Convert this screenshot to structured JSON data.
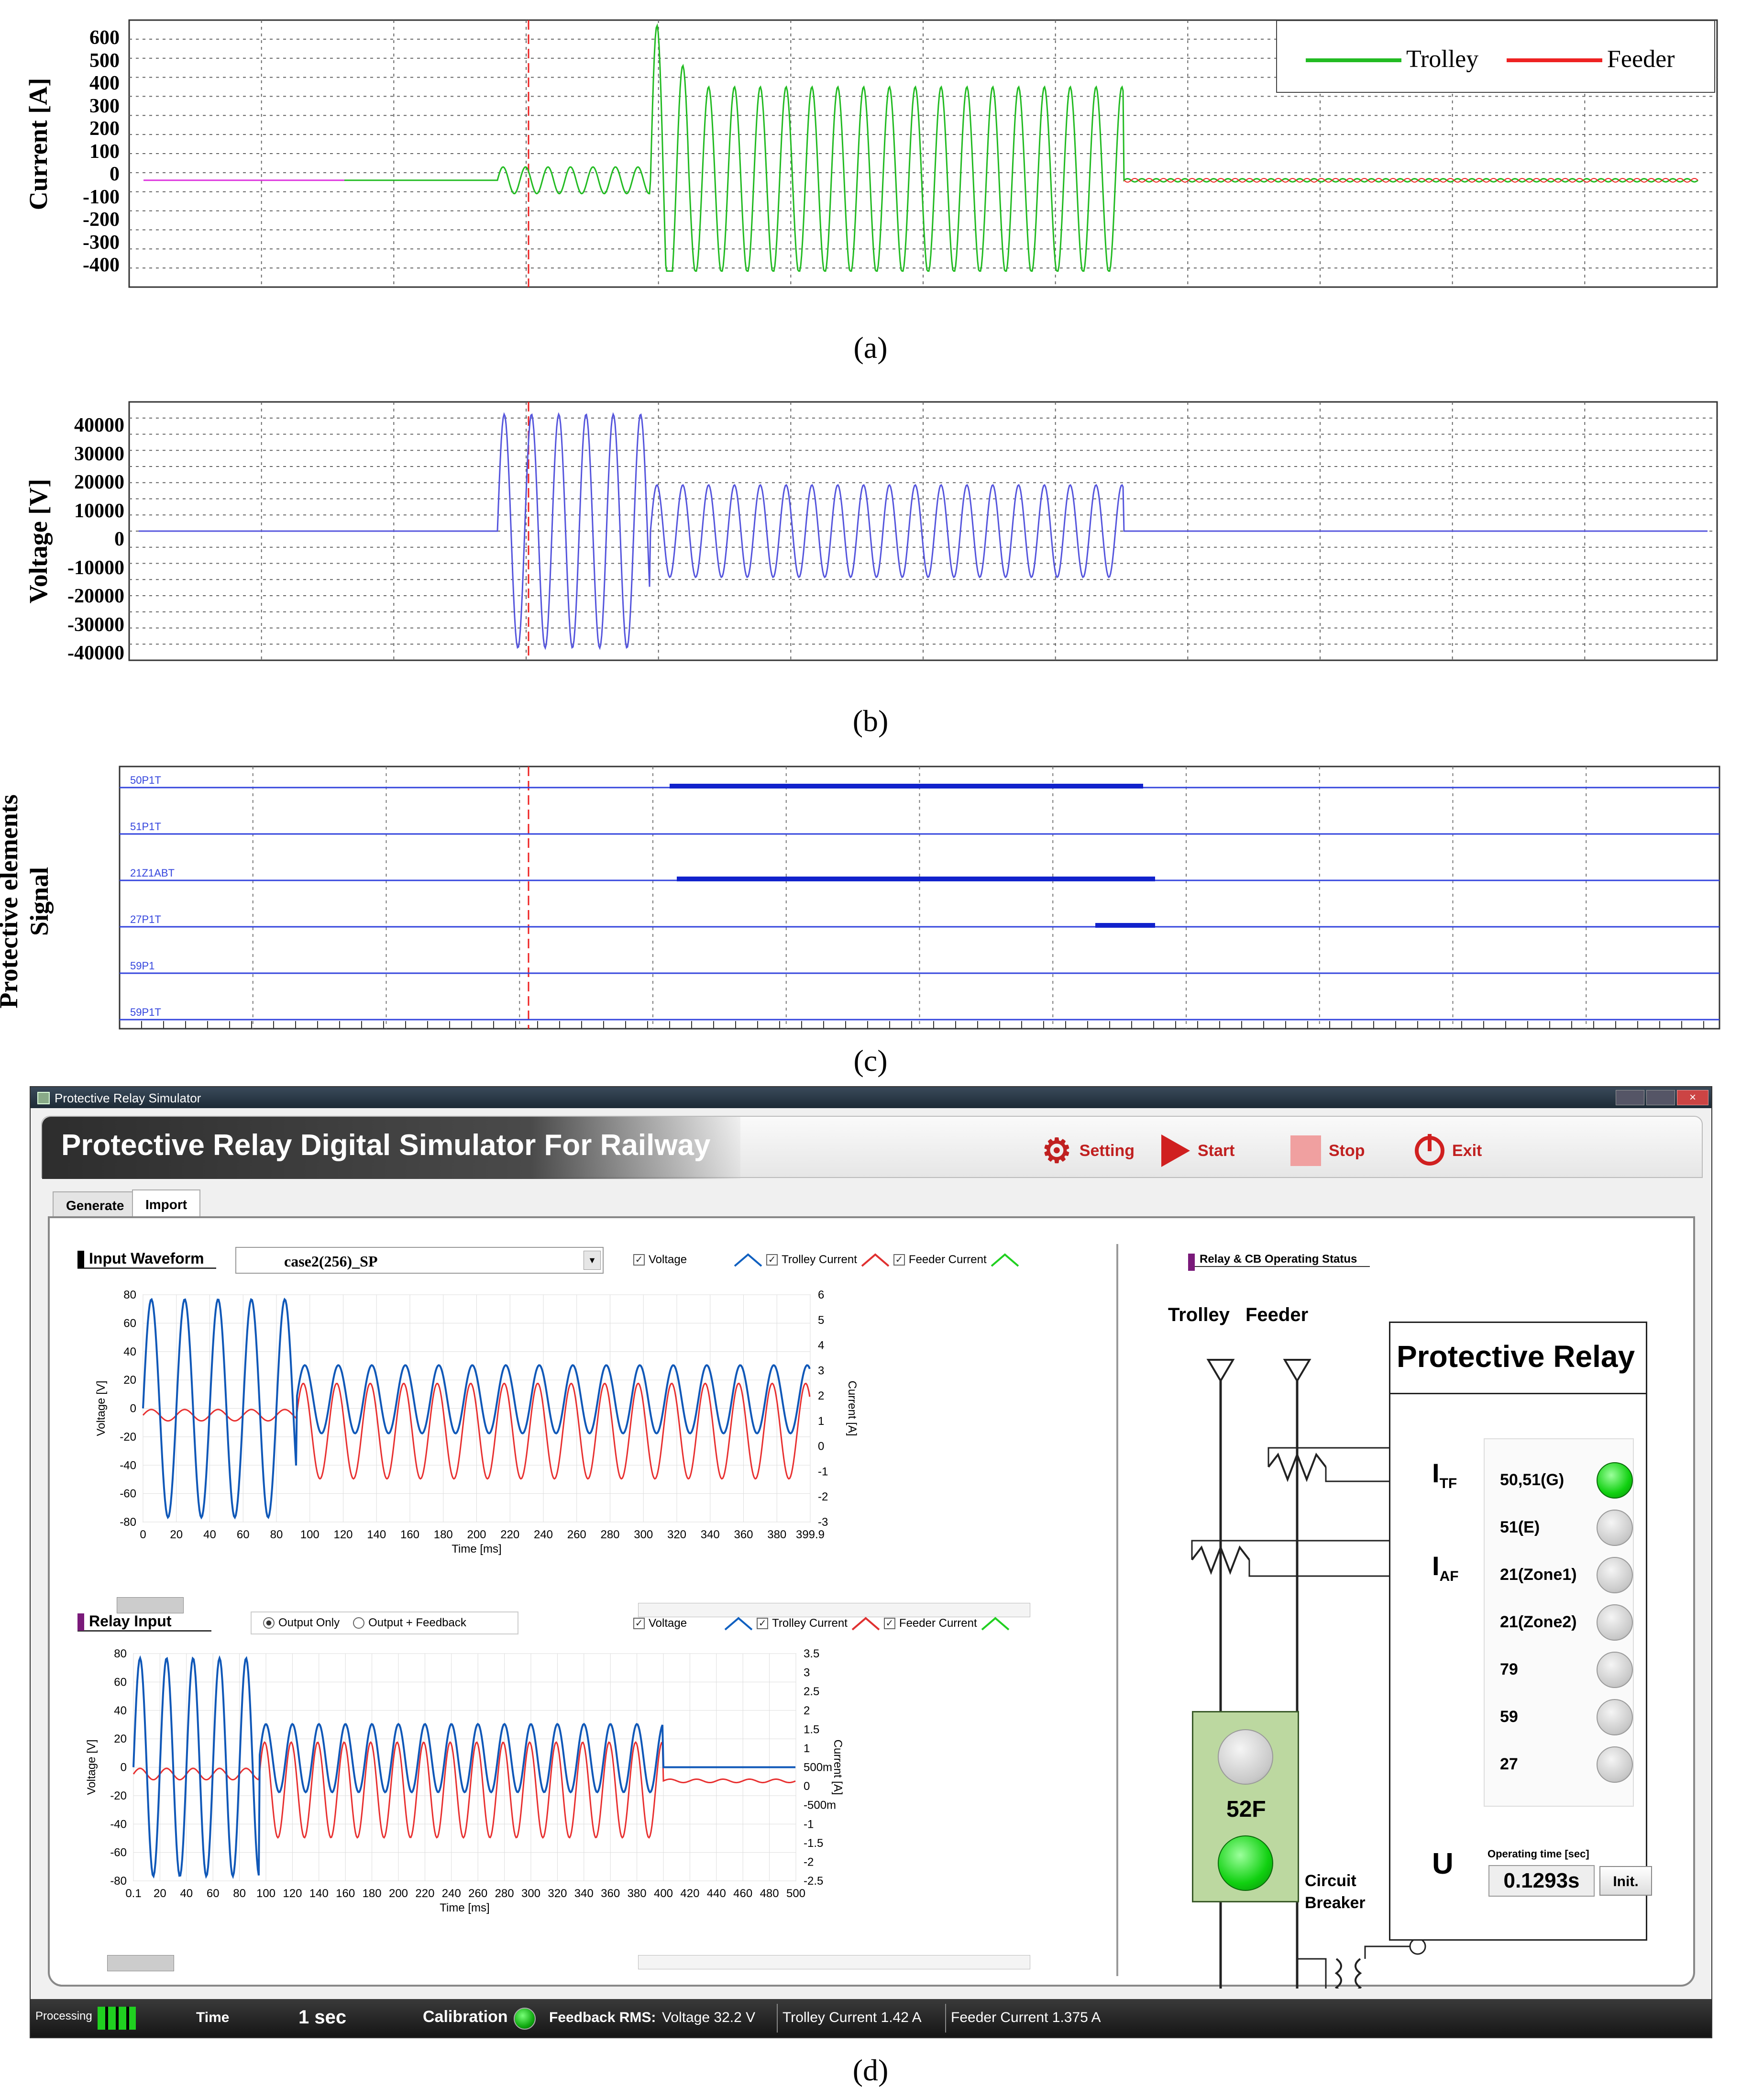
{
  "captions": {
    "a": "(a)",
    "b": "(b)",
    "c": "(c)",
    "d": "(d)"
  },
  "chart_a": {
    "ylabel": "Current [A]",
    "yticks": [
      "600",
      "500",
      "400",
      "300",
      "200",
      "100",
      "0",
      "-100",
      "-200",
      "-300",
      "-400"
    ],
    "legend": [
      {
        "name": "Trolley",
        "color": "#22bb22"
      },
      {
        "name": "Feeder",
        "color": "#ee2222"
      }
    ]
  },
  "chart_b": {
    "ylabel": "Voltage [V]",
    "yticks": [
      "40000",
      "30000",
      "20000",
      "10000",
      "0",
      "-10000",
      "-20000",
      "-30000",
      "-40000"
    ],
    "color": "#5555dd"
  },
  "chart_c": {
    "ylabel_line1": "Protective elements",
    "ylabel_line2": "Signal",
    "signals": [
      "50P1T",
      "51P1T",
      "21Z1ABT",
      "27P1T",
      "59P1",
      "59P1T"
    ]
  },
  "chart_data": [
    {
      "type": "line",
      "ylabel": "Current [A]",
      "ylim": [
        -400,
        600
      ],
      "series": [
        {
          "name": "Trolley",
          "peak_fault": 350,
          "peak_first": 580
        },
        {
          "name": "Feeder"
        }
      ],
      "grid": true,
      "legend": "top-right"
    },
    {
      "type": "line",
      "ylabel": "Voltage [V]",
      "ylim": [
        -40000,
        40000
      ],
      "series": [
        {
          "amplitude_pre": 38000,
          "amplitude_fault": 15000
        }
      ],
      "grid": true
    },
    {
      "type": "line",
      "ylabel": "Protective elements Signal",
      "categories": [
        "50P1T",
        "51P1T",
        "21Z1ABT",
        "27P1T",
        "59P1",
        "59P1T"
      ]
    }
  ],
  "app": {
    "window_title": "Protective Relay Simulator",
    "title": "Protective Relay Digital Simulator For Railway",
    "toolbar": {
      "setting": "Setting",
      "start": "Start",
      "stop": "Stop",
      "exit": "Exit"
    },
    "tabs": [
      "Generate",
      "Import"
    ],
    "input_waveform": {
      "title": "Input Waveform",
      "file": "case2(256)_SP",
      "checks": [
        "Voltage",
        "Trolley Current",
        "Feeder Current"
      ],
      "yleft": [
        "80",
        "60",
        "40",
        "20",
        "0",
        "-20",
        "-40",
        "-60",
        "-80"
      ],
      "yright": [
        "6",
        "5",
        "4",
        "3",
        "2",
        "1",
        "0",
        "-1",
        "-2",
        "-3"
      ],
      "xticks": [
        "0",
        "20",
        "40",
        "60",
        "80",
        "100",
        "120",
        "140",
        "160",
        "180",
        "200",
        "220",
        "240",
        "260",
        "280",
        "300",
        "320",
        "340",
        "360",
        "380",
        "399.9"
      ],
      "xlabel": "Time [ms]",
      "ylabel_left": "Voltage [V]",
      "ylabel_right": "Current [A]"
    },
    "relay_input": {
      "title": "Relay Input",
      "radio": [
        "Output Only",
        "Output + Feedback"
      ],
      "checks": [
        "Voltage",
        "Trolley Current",
        "Feeder Current"
      ],
      "yleft": [
        "80",
        "60",
        "40",
        "20",
        "0",
        "-20",
        "-40",
        "-60",
        "-80"
      ],
      "yright": [
        "3.5",
        "3",
        "2.5",
        "2",
        "1.5",
        "1",
        "500m",
        "0",
        "-500m",
        "-1",
        "-1.5",
        "-2",
        "-2.5"
      ],
      "xticks": [
        "0.1",
        "20",
        "40",
        "60",
        "80",
        "100",
        "120",
        "140",
        "160",
        "180",
        "200",
        "220",
        "240",
        "260",
        "280",
        "300",
        "320",
        "340",
        "360",
        "380",
        "400",
        "420",
        "440",
        "460",
        "480",
        "500"
      ],
      "xlabel": "Time [ms]",
      "ylabel_left": "Voltage [V]",
      "ylabel_right": "Current [A]"
    },
    "status_panel": {
      "title": "Relay & CB Operating Status",
      "trolley": "Trolley",
      "feeder": "Feeder",
      "relay_title": "Protective Relay",
      "itf": "I",
      "itf_sub": "TF",
      "iaf": "I",
      "iaf_sub": "AF",
      "u": "U",
      "breaker": "52F",
      "breaker_label_1": "Circuit",
      "breaker_label_2": "Breaker",
      "elements": [
        {
          "label": "50,51(G)",
          "on": true
        },
        {
          "label": "51(E)",
          "on": false
        },
        {
          "label": "21(Zone1)",
          "on": false
        },
        {
          "label": "21(Zone2)",
          "on": false
        },
        {
          "label": "79",
          "on": false
        },
        {
          "label": "59",
          "on": false
        },
        {
          "label": "27",
          "on": false
        }
      ],
      "op_time_label": "Operating time [sec]",
      "op_time": "0.1293s",
      "init": "Init."
    },
    "statusbar": {
      "processing": "Processing",
      "time_label": "Time",
      "time_value": "1 sec",
      "calibration": "Calibration",
      "feedback": "Feedback RMS:",
      "voltage": "Voltage  32.2 V",
      "trolley": "Trolley  Current      1.42 A",
      "feeder": "Feeder Current    1.375 A"
    }
  }
}
